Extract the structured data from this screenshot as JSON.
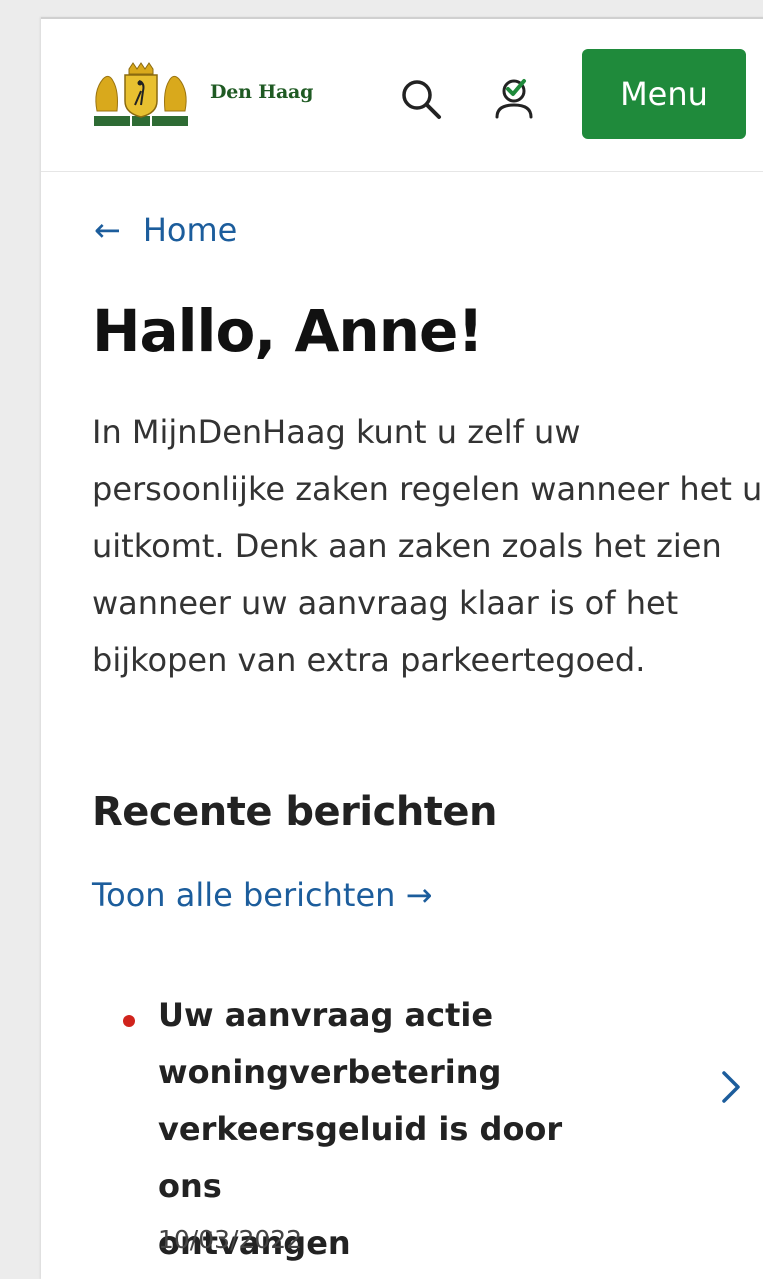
{
  "header": {
    "logo_text": "Den Haag",
    "crest_motto_left": "VREDE",
    "crest_motto_middle": "EN",
    "crest_motto_right": "RECHT",
    "menu_label": "Menu"
  },
  "breadcrumb": {
    "back_label": "Home"
  },
  "main": {
    "title": "Hallo, Anne!",
    "intro_lines": [
      "In MijnDenHaag kunt u zelf uw",
      "persoonlijke zaken regelen wanneer het u",
      "uitkomt. Denk aan zaken zoals het zien",
      "wanneer uw aanvraag klaar is of het",
      "bijkopen van extra parkeertegoed."
    ]
  },
  "messages": {
    "section_title": "Recente berichten",
    "all_link_label": "Toon alle berichten →",
    "items": [
      {
        "title_lines": [
          "Uw aanvraag actie",
          "woningverbetering",
          "verkeersgeluid is door ons",
          "ontvangen"
        ],
        "date": "10/03/2022",
        "unread": true
      }
    ]
  },
  "colors": {
    "brand_green": "#1f8a3b",
    "link_blue": "#1c5d9c",
    "unread_red": "#d0231c"
  }
}
